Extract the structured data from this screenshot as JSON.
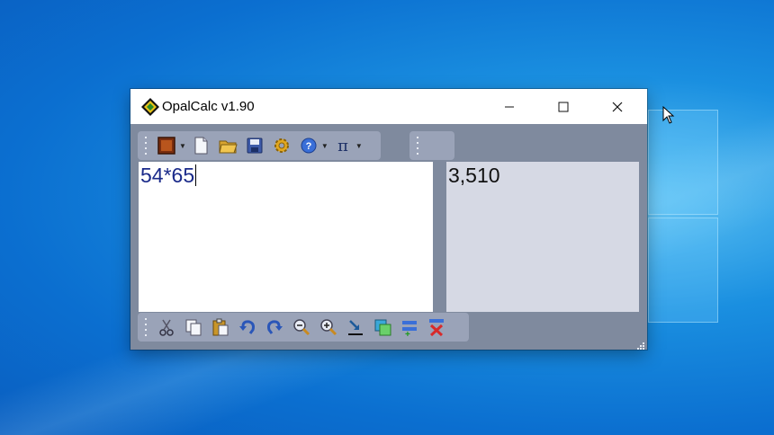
{
  "window": {
    "title": "OpalCalc v1.90"
  },
  "titlebar_buttons": {
    "minimize": "—",
    "maximize": "☐",
    "close": "✕"
  },
  "editor": {
    "input": "54*65",
    "result": "3,510"
  },
  "toolbar_top": {
    "icons": [
      "color-scheme-icon",
      "new-document-icon",
      "open-folder-icon",
      "save-icon",
      "settings-gear-icon",
      "help-icon",
      "pi-icon"
    ]
  },
  "toolbar_bottom": {
    "icons": [
      "cut-icon",
      "copy-icon",
      "paste-icon",
      "undo-icon",
      "redo-icon",
      "zoom-out-icon",
      "zoom-in-icon",
      "insert-result-icon",
      "copy-result-icon",
      "add-line-icon",
      "clear-icon"
    ]
  },
  "colors": {
    "window_body": "#7f8a9e",
    "toolbar": "#9aa3b8",
    "input_text": "#1a2a8a",
    "output_bg": "#d6d9e4"
  }
}
